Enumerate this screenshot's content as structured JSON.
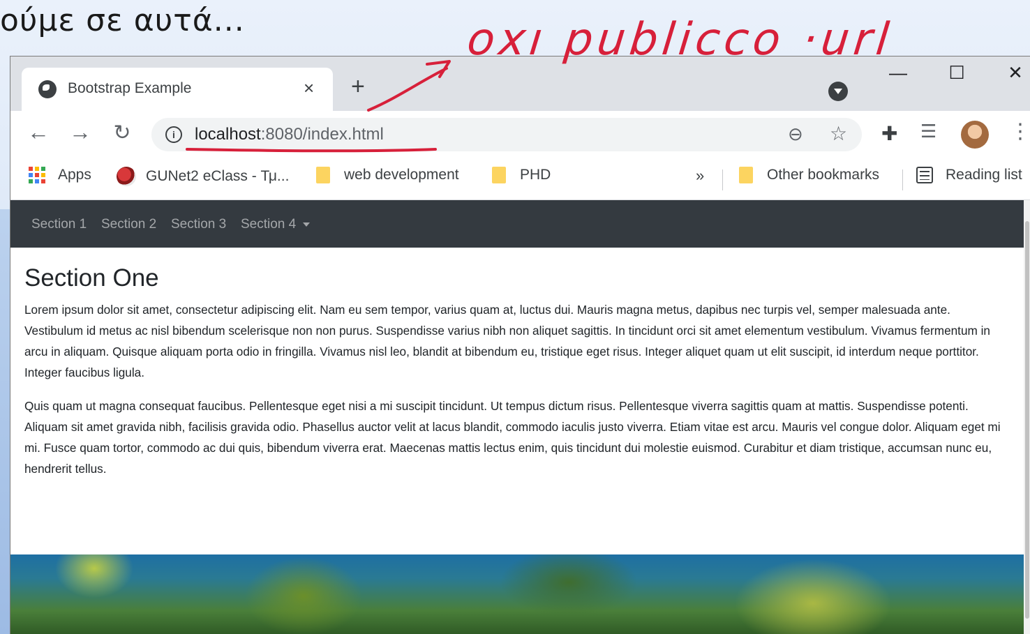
{
  "slide": {
    "caption": "ούμε σε αυτά...",
    "annotation": "oxı publicco ·url"
  },
  "browser": {
    "tab_title": "Bootstrap Example",
    "tab_close": "×",
    "new_tab": "+",
    "window_controls": {
      "minimize": "—",
      "maximize": "☐",
      "close": "✕"
    },
    "url_host": "localhost",
    "url_rest": ":8080/index.html",
    "bookmarks": {
      "apps": "Apps",
      "eclass": "GUNet2 eClass - Τμ...",
      "webdev": "web development",
      "phd": "PHD",
      "more": "»",
      "other": "Other bookmarks",
      "reading_list": "Reading list"
    },
    "icons": {
      "back": "back-arrow-icon",
      "forward": "forward-arrow-icon",
      "reload": "reload-icon",
      "info": "info-icon",
      "zoom": "zoom-out-icon",
      "star": "bookmark-star-icon",
      "extensions": "puzzle-extensions-icon",
      "media": "media-controls-icon",
      "menu": "kebab-menu-icon"
    }
  },
  "page": {
    "navbar": {
      "links": [
        "Section 1",
        "Section 2",
        "Section 3",
        "Section 4"
      ]
    },
    "heading": "Section One",
    "paragraphs": [
      "Lorem ipsum dolor sit amet, consectetur adipiscing elit. Nam eu sem tempor, varius quam at, luctus dui. Mauris magna metus, dapibus nec turpis vel, semper malesuada ante. Vestibulum id metus ac nisl bibendum scelerisque non non purus. Suspendisse varius nibh non aliquet sagittis. In tincidunt orci sit amet elementum vestibulum. Vivamus fermentum in arcu in aliquam. Quisque aliquam porta odio in fringilla. Vivamus nisl leo, blandit at bibendum eu, tristique eget risus. Integer aliquet quam ut elit suscipit, id interdum neque porttitor. Integer faucibus ligula.",
      "Quis quam ut magna consequat faucibus. Pellentesque eget nisi a mi suscipit tincidunt. Ut tempus dictum risus. Pellentesque viverra sagittis quam at mattis. Suspendisse potenti. Aliquam sit amet gravida nibh, facilisis gravida odio. Phasellus auctor velit at lacus blandit, commodo iaculis justo viverra. Etiam vitae est arcu. Mauris vel congue dolor. Aliquam eget mi mi. Fusce quam tortor, commodo ac dui quis, bibendum viverra erat. Maecenas mattis lectus enim, quis tincidunt dui molestie euismod. Curabitur et diam tristique, accumsan nunc eu, hendrerit tellus."
    ]
  },
  "colors": {
    "annotation": "#d7203a",
    "navbar_bg": "#343a40",
    "tabstrip_bg": "#dee1e6"
  }
}
